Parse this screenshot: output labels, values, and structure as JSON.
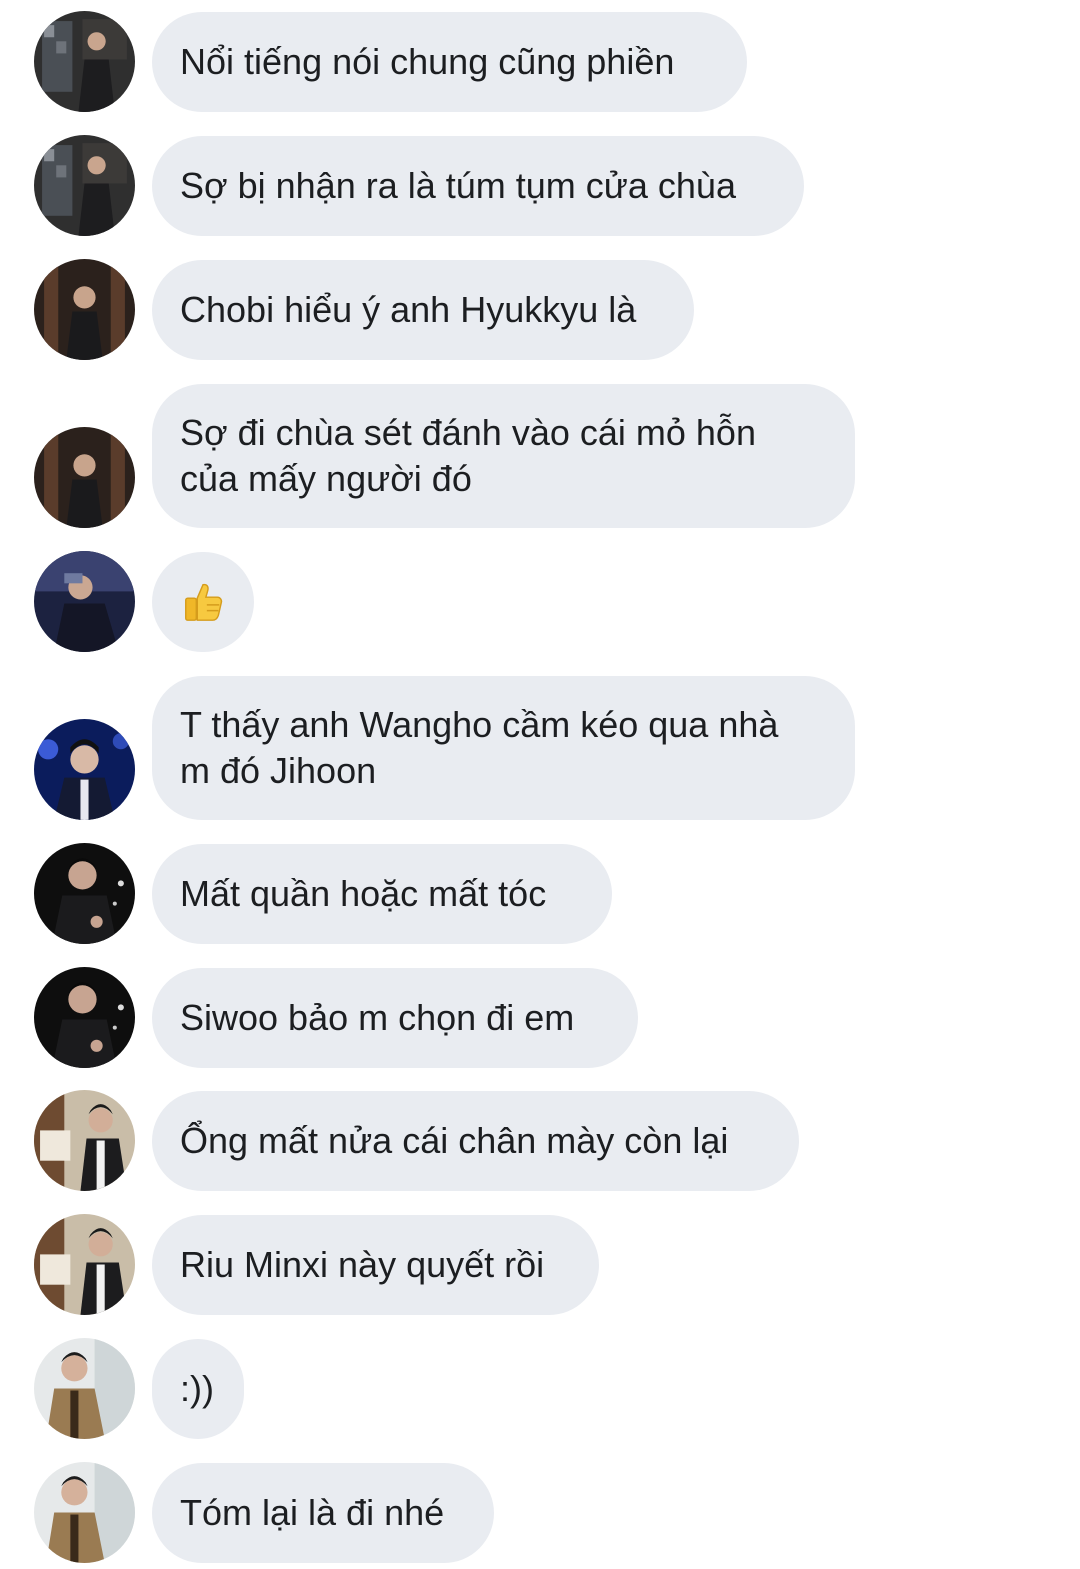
{
  "messages": [
    {
      "text": "Nổi tiếng nói chung cũng phiền",
      "avatar": "avatar-a"
    },
    {
      "text": "Sợ bị nhận ra là túm tụm cửa chùa",
      "avatar": "avatar-a"
    },
    {
      "text": "Chobi hiểu ý anh Hyukkyu là",
      "avatar": "avatar-b"
    },
    {
      "text": "Sợ đi chùa sét đánh vào cái mỏ hỗn\ncủa mấy người đó",
      "avatar": "avatar-b"
    },
    {
      "text": "",
      "avatar": "avatar-c",
      "icon": "thumbs-up-icon"
    },
    {
      "text": "T thấy anh Wangho cầm kéo qua nhà\nm đó Jihoon",
      "avatar": "avatar-d"
    },
    {
      "text": "Mất quần hoặc mất tóc",
      "avatar": "avatar-e"
    },
    {
      "text": "Siwoo bảo m chọn đi em",
      "avatar": "avatar-e"
    },
    {
      "text": "Ổng mất nửa cái chân mày còn lại",
      "avatar": "avatar-f"
    },
    {
      "text": "Riu Minxi này quyết rồi",
      "avatar": "avatar-f"
    },
    {
      "text": ":))",
      "avatar": "avatar-g"
    },
    {
      "text": "Tóm lại là đi nhé",
      "avatar": "avatar-g"
    }
  ],
  "colors": {
    "bubble": "#e9ecf1",
    "text": "#1c1e21",
    "background": "#ffffff"
  }
}
